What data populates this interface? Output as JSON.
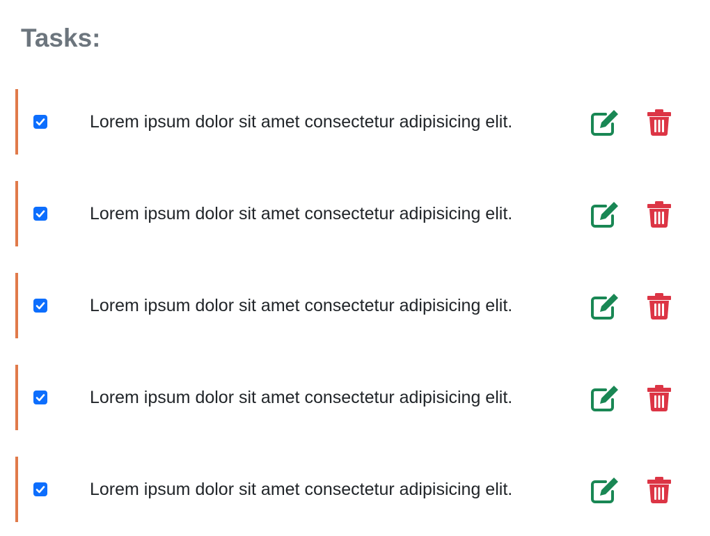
{
  "header": {
    "title": "Tasks:"
  },
  "colors": {
    "accent_bar": "#e07a4a",
    "checkbox": "#0d6efd",
    "edit": "#198754",
    "delete": "#dc3545",
    "title": "#6c757d",
    "text": "#212529"
  },
  "tasks": [
    {
      "text": "Lorem ipsum dolor sit amet consectetur adipisicing elit.",
      "checked": true,
      "edit_icon": "edit-icon",
      "delete_icon": "trash-icon"
    },
    {
      "text": "Lorem ipsum dolor sit amet consectetur adipisicing elit.",
      "checked": true,
      "edit_icon": "edit-icon",
      "delete_icon": "trash-icon"
    },
    {
      "text": "Lorem ipsum dolor sit amet consectetur adipisicing elit.",
      "checked": true,
      "edit_icon": "edit-icon",
      "delete_icon": "trash-icon"
    },
    {
      "text": "Lorem ipsum dolor sit amet consectetur adipisicing elit.",
      "checked": true,
      "edit_icon": "edit-icon",
      "delete_icon": "trash-icon"
    },
    {
      "text": "Lorem ipsum dolor sit amet consectetur adipisicing elit.",
      "checked": true,
      "edit_icon": "edit-icon",
      "delete_icon": "trash-icon"
    }
  ]
}
